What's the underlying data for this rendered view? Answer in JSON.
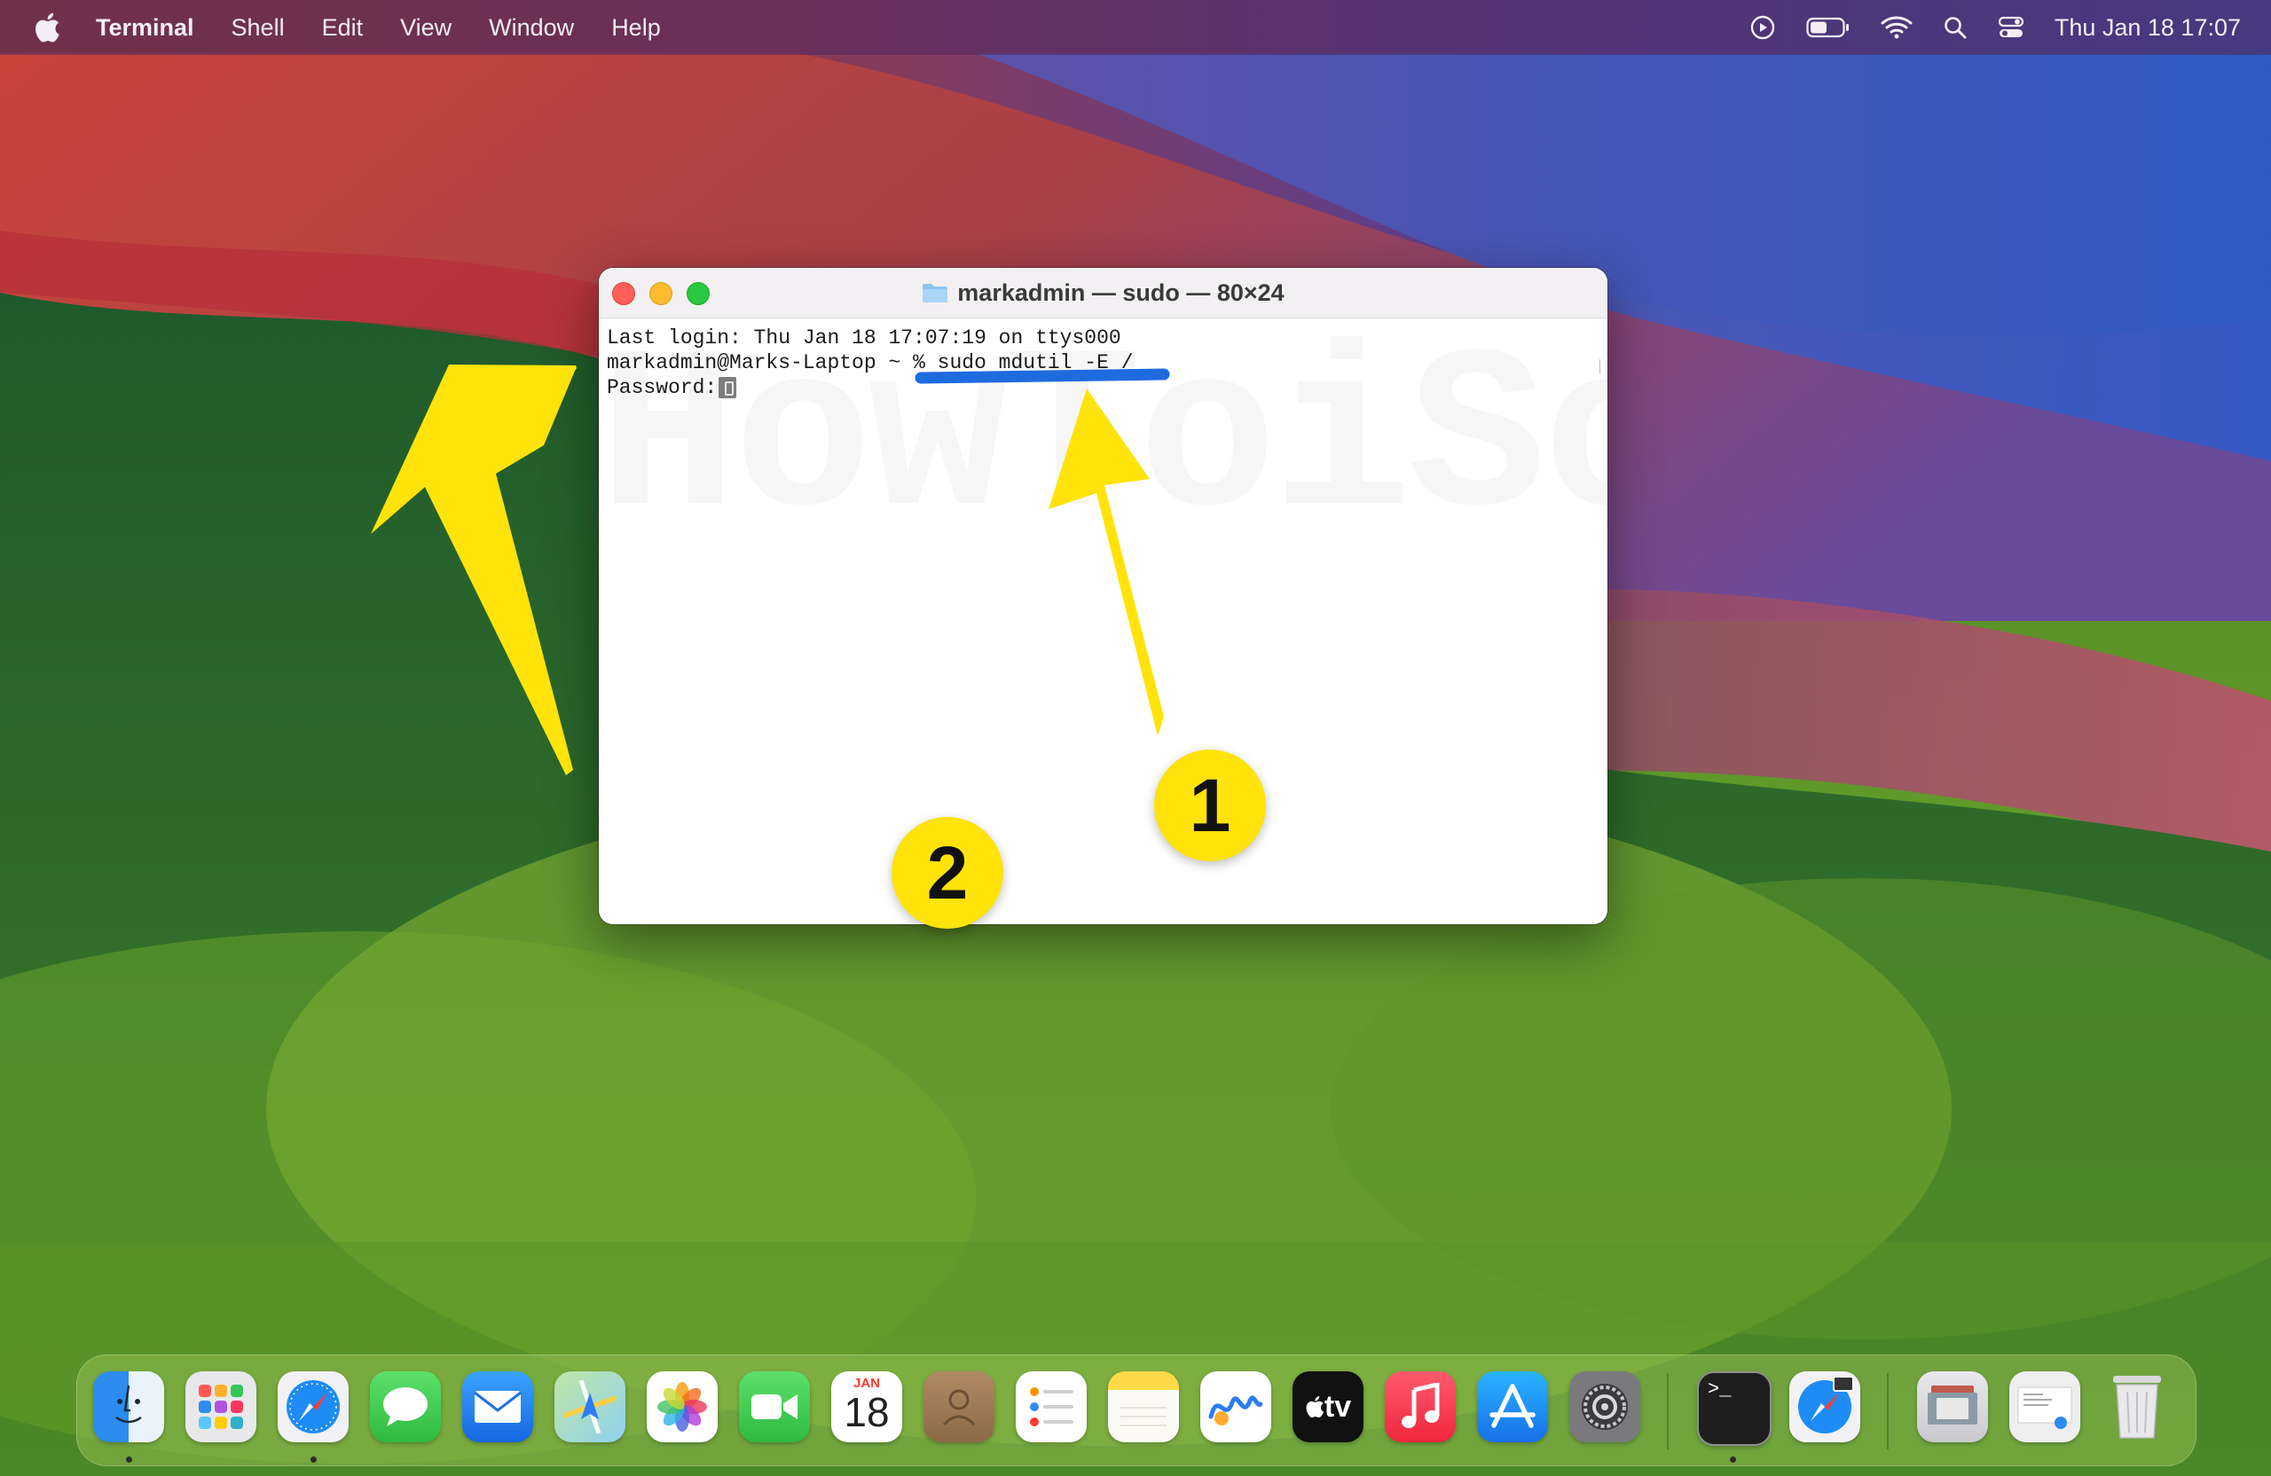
{
  "menubar": {
    "apple_icon": "apple-logo-icon",
    "app_name": "Terminal",
    "menus": [
      "Shell",
      "Edit",
      "View",
      "Window",
      "Help"
    ],
    "status_icons": [
      "play-circle-icon",
      "battery-icon",
      "wifi-icon",
      "search-icon",
      "control-center-icon"
    ],
    "clock": "Thu Jan 18  17:07"
  },
  "terminal": {
    "title": "markadmin — sudo — 80×24",
    "lines": {
      "line1": "Last login: Thu Jan 18 17:07:19 on ttys000",
      "line2": "markadmin@Marks-Laptop ~ % sudo mdutil -E /",
      "line3": "Password:"
    },
    "watermark": "HowToiSolve.com"
  },
  "annotations": {
    "badge1": "1",
    "badge2": "2",
    "arrow_color": "#ffe30a",
    "underline_color": "#1e6be0"
  },
  "dock": {
    "apps": [
      "Finder",
      "Launchpad",
      "Safari",
      "Messages",
      "Mail",
      "Maps",
      "Photos",
      "FaceTime",
      "Calendar",
      "Contacts",
      "Reminders",
      "Notes",
      "Freeform",
      "TV",
      "Music",
      "App Store",
      "System Settings",
      "Terminal",
      "Safari (Handoff)",
      "Screenshots Folder",
      "Recent Document",
      "Trash"
    ],
    "calendar_month": "JAN",
    "calendar_day": "18",
    "tv_label": "tv",
    "terminal_prompt": ">_"
  }
}
